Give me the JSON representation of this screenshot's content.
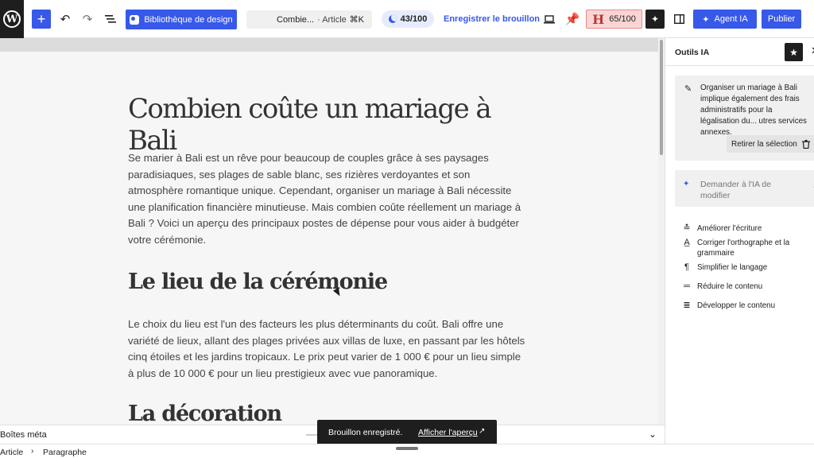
{
  "toolbar": {
    "wp_logo": "W",
    "add_label": "+",
    "design_library": "Bibliothèque de design",
    "doc_title": "Combie...",
    "doc_type": "· Article",
    "doc_shortcut": "⌘K",
    "seo_score": "43/100",
    "save_draft": "Enregistrer le brouillon",
    "readability_letter": "H",
    "readability_score": "65/100",
    "agent_label": "Agent IA",
    "publish": "Publier"
  },
  "post": {
    "title": "Combien coûte un mariage à Bali",
    "intro": "Se marier à Bali est un rêve pour beaucoup de couples grâce à ses paysages paradisiaques, ses plages de sable blanc, ses rizières verdoyantes et son atmosphère romantique unique. Cependant, organiser un mariage à Bali nécessite une planification financière minutieuse. Mais combien coûte réellement un mariage à Bali ? Voici un aperçu des principaux postes de dépense pour vous aider à budgéter votre cérémonie.",
    "h2_venue": "Le lieu de la cérémonie",
    "venue_text": "Le choix du lieu est l'un des facteurs les plus déterminants du coût. Bali offre une variété de lieux, allant des plages privées aux villas de luxe, en passant par les hôtels cinq étoiles et les jardins tropicaux. Le prix peut varier de 1 000 € pour un lieu simple à plus de 10 000 € pour un lieu prestigieux avec vue panoramique.",
    "h2_decor": "La décoration"
  },
  "metabox": {
    "label": "Boîtes méta"
  },
  "footer": {
    "crumb_root": "Article",
    "crumb_sep": "›",
    "crumb_current": "Paragraphe"
  },
  "snackbar": {
    "message": "Brouillon enregistré.",
    "link": "Afficher l'aperçu",
    "arrow": "↗"
  },
  "sidebar": {
    "title": "Outils IA",
    "selection_text": "Organiser un mariage à Bali implique également des frais administratifs pour la légalisation du... utres services annexes.",
    "clear_selection": "Retirer la sélection",
    "ask_placeholder": "Demander à l'IA de modifier",
    "tools": [
      {
        "label": "Améliorer l'écriture",
        "icon": "improve-icon"
      },
      {
        "label": "Corriger l'orthographe et la grammaire",
        "icon": "spellcheck-icon"
      },
      {
        "label": "Simplifier le langage",
        "icon": "pilcrow-icon"
      },
      {
        "label": "Réduire le contenu",
        "icon": "shorten-icon"
      },
      {
        "label": "Développer le contenu",
        "icon": "expand-icon"
      }
    ]
  },
  "colors": {
    "accent": "#3858e9",
    "dark": "#1e1e1e",
    "readability_bg": "#fbd5d5"
  }
}
